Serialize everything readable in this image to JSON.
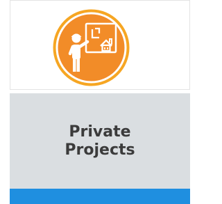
{
  "card": {
    "title": "Private Projects",
    "icon": "presentation-house-icon"
  },
  "colors": {
    "circle_outer": "#F6A623",
    "circle_inner": "#F28C28",
    "title_panel": "#DADEE1",
    "title_text": "#3B3B3B",
    "accent_bar": "#1F8FE0"
  }
}
